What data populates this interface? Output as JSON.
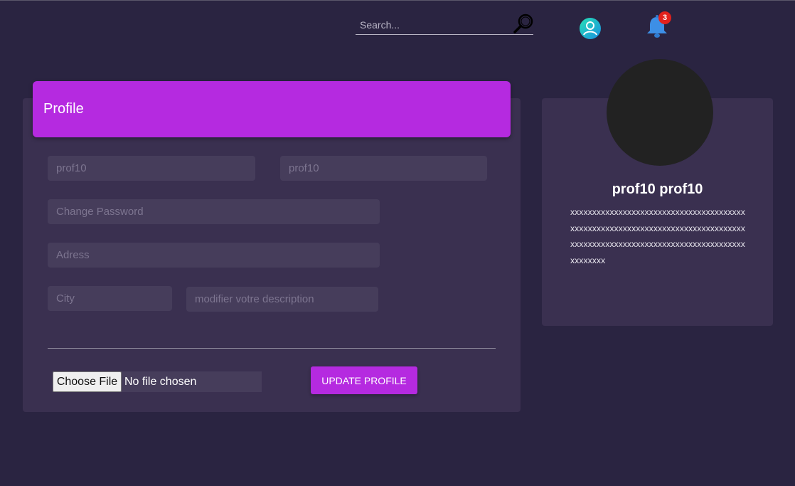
{
  "header": {
    "search_placeholder": "Search...",
    "notification_count": "3",
    "icons": [
      "search-icon",
      "user-avatar-icon",
      "bell-icon"
    ]
  },
  "profile_form": {
    "title": "Profile",
    "first_name_value": "prof10",
    "last_name_value": "prof10",
    "password_placeholder": "Change Password",
    "address_placeholder": "Adress",
    "city_placeholder": "City",
    "description_placeholder": "modifier votre description",
    "file_button_label": "Choose File",
    "file_status": "No file chosen",
    "update_button_label": "UPDATE PROFILE"
  },
  "profile_card": {
    "name": "prof10 prof10",
    "description": "xxxxxxxxxxxxxxxxxxxxxxxxxxxxxxxxxxxxxxxxxxxxxxxxxxxxxxxxxxxxxxxxxxxxxxxxxxxxxxxxxxxxxxxxxxxxxxxxxxxxxxxxxxxxxxxxxxxxxxxxxxxxxxxx"
  },
  "colors": {
    "background": "#2a2441",
    "card": "#3a3050",
    "accent": "#b52ae0",
    "badge": "#e2211c"
  }
}
